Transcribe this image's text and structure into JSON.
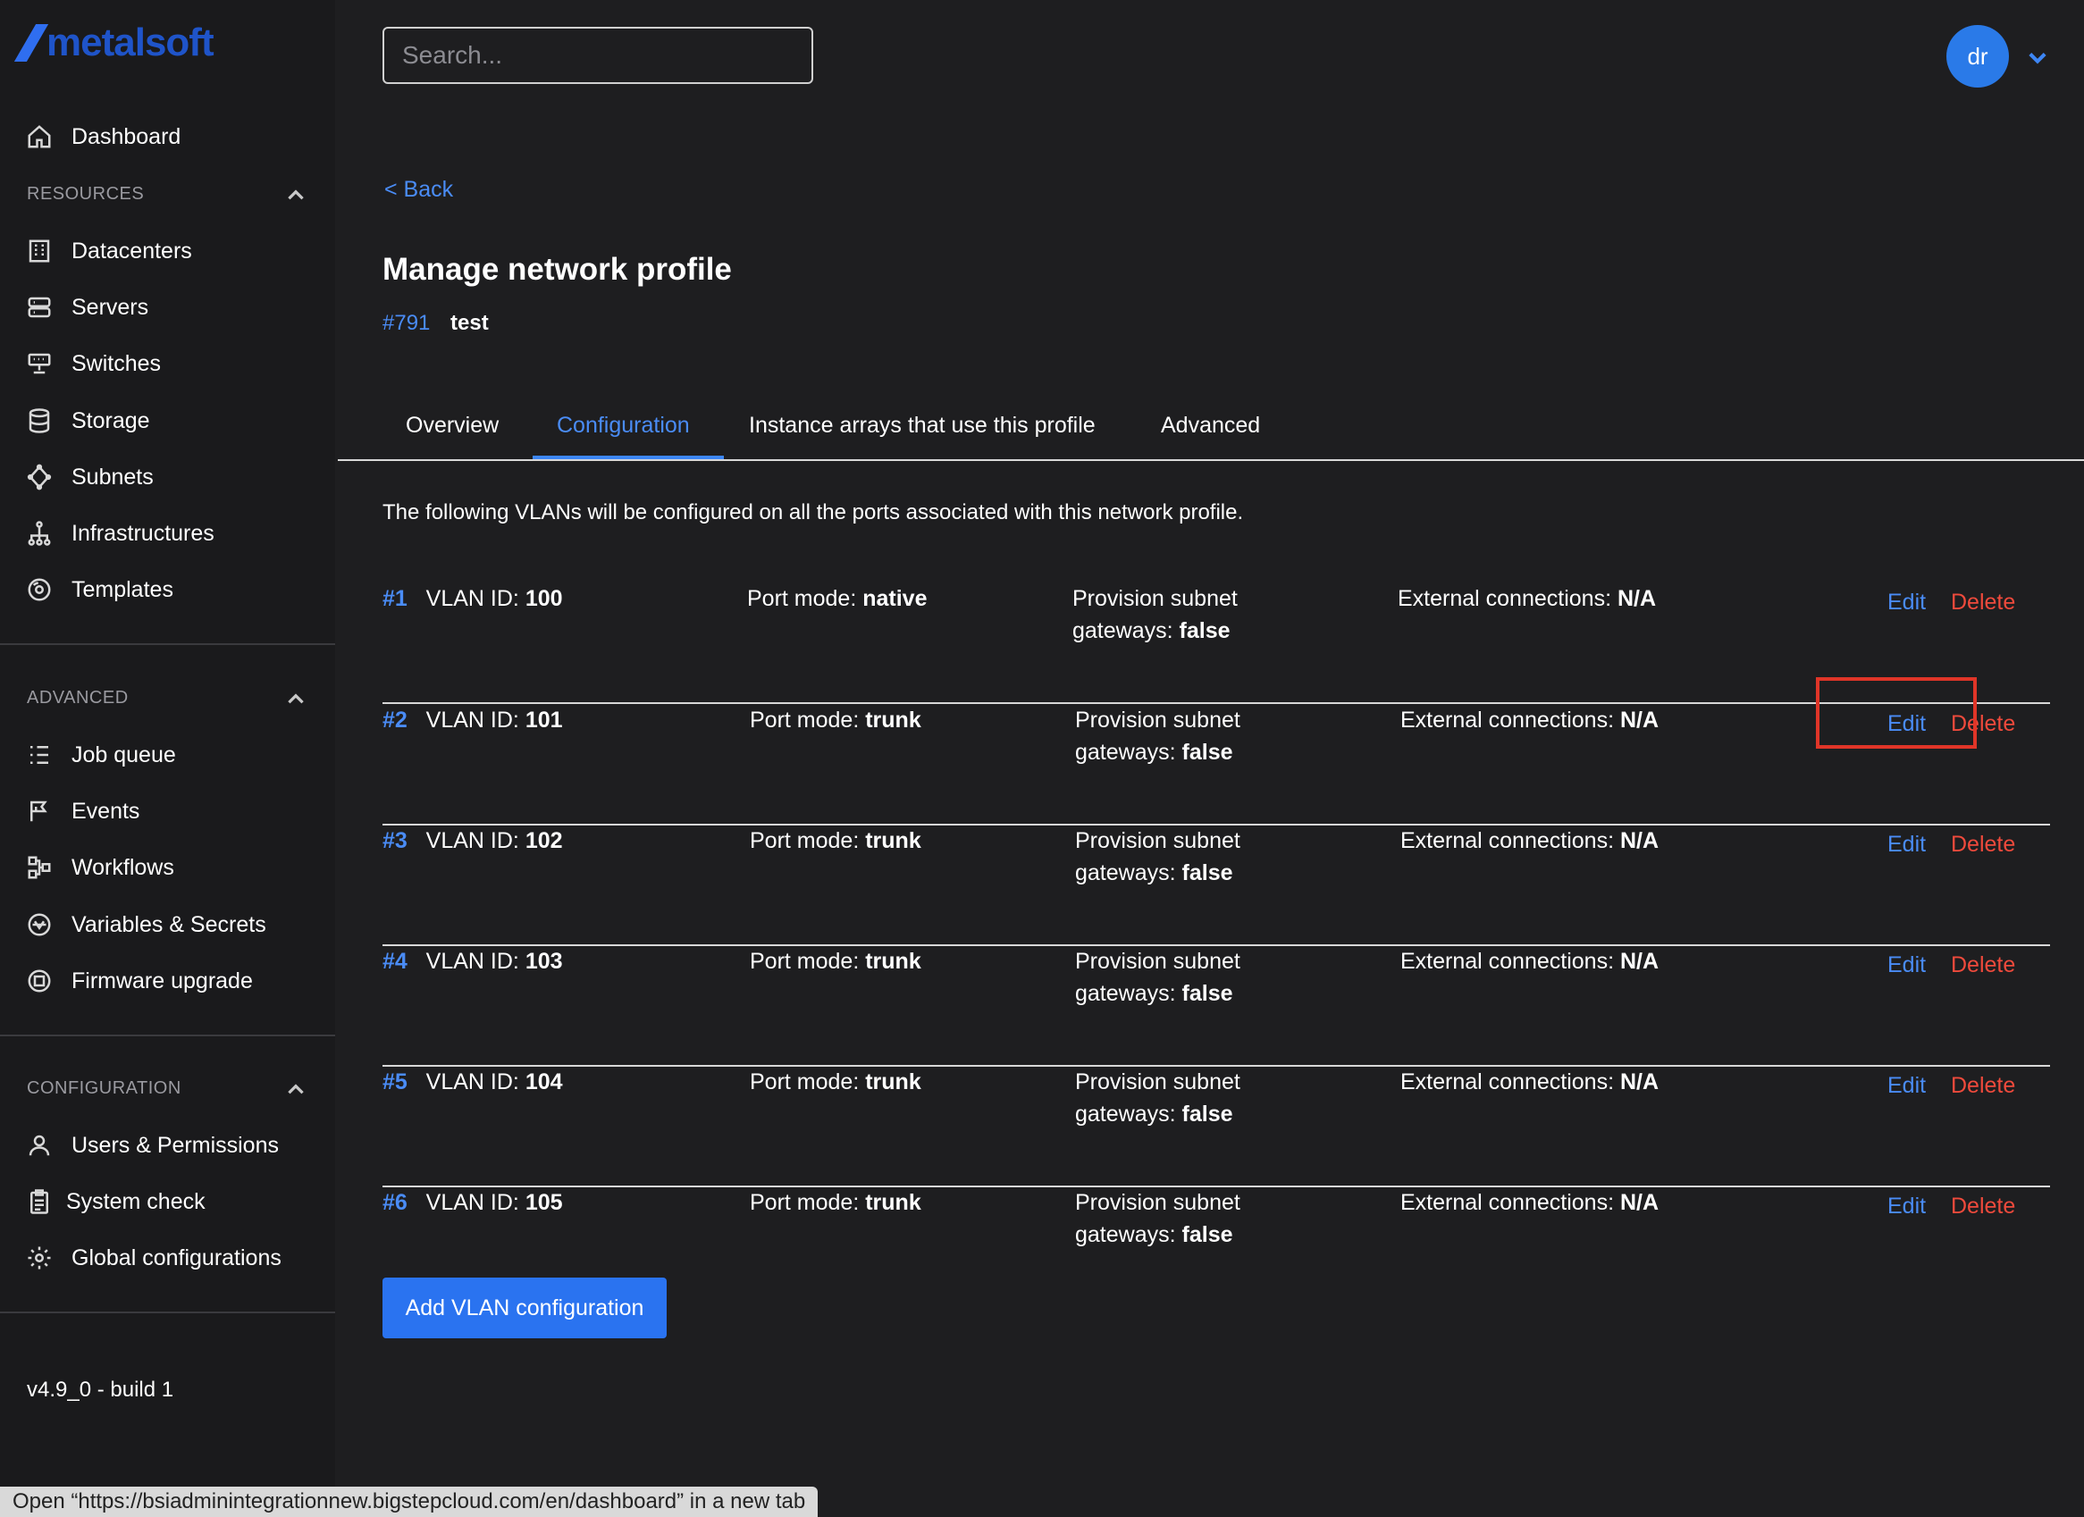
{
  "app": {
    "logo_text": "metalsoft"
  },
  "search": {
    "placeholder": "Search..."
  },
  "user": {
    "initials": "dr"
  },
  "sidebar": {
    "dashboard": "Dashboard",
    "resources_label": "RESOURCES",
    "resources": [
      "Datacenters",
      "Servers",
      "Switches",
      "Storage",
      "Subnets",
      "Infrastructures",
      "Templates"
    ],
    "advanced_label": "ADVANCED",
    "advanced": [
      "Job queue",
      "Events",
      "Workflows",
      "Variables & Secrets",
      "Firmware upgrade"
    ],
    "configuration_label": "CONFIGURATION",
    "configuration": [
      "Users & Permissions",
      "System check",
      "Global configurations"
    ],
    "version": "v4.9_0 - build 1"
  },
  "page": {
    "back": "< Back",
    "title": "Manage network profile",
    "profile_id": "#791",
    "profile_name": "test",
    "tabs": [
      "Overview",
      "Configuration",
      "Instance arrays that use this profile",
      "Advanced"
    ],
    "active_tab": "Configuration",
    "intro": "The following VLANs will be configured on all the ports associated with this network profile."
  },
  "vlan_labels": {
    "vlan_id": "VLAN ID:",
    "port_mode": "Port mode:",
    "provision_line1": "Provision subnet",
    "provision_line2": "gateways:",
    "external": "External connections:",
    "edit": "Edit",
    "delete": "Delete"
  },
  "vlans": [
    {
      "num": "#1",
      "vlan_id": "100",
      "port_mode": "native",
      "gateways": "false",
      "external": "N/A"
    },
    {
      "num": "#2",
      "vlan_id": "101",
      "port_mode": "trunk",
      "gateways": "false",
      "external": "N/A"
    },
    {
      "num": "#3",
      "vlan_id": "102",
      "port_mode": "trunk",
      "gateways": "false",
      "external": "N/A"
    },
    {
      "num": "#4",
      "vlan_id": "103",
      "port_mode": "trunk",
      "gateways": "false",
      "external": "N/A"
    },
    {
      "num": "#5",
      "vlan_id": "104",
      "port_mode": "trunk",
      "gateways": "false",
      "external": "N/A"
    },
    {
      "num": "#6",
      "vlan_id": "105",
      "port_mode": "trunk",
      "gateways": "false",
      "external": "N/A"
    }
  ],
  "add_button": "Add VLAN configuration",
  "status_bar": "Open “https://bsiadminintegrationnew.bigstepcloud.com/en/dashboard” in a new tab",
  "colors": {
    "accent": "#3d86f5",
    "danger": "#ef4a3c",
    "background": "#1e1e20",
    "highlight": "#e03528"
  }
}
